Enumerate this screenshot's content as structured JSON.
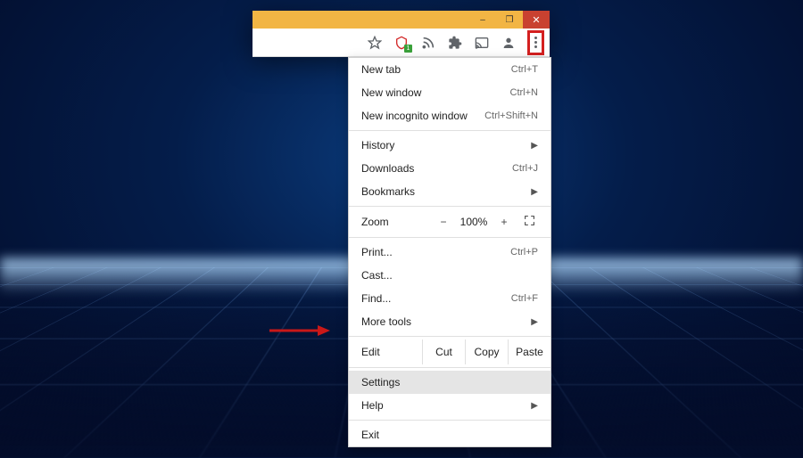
{
  "window": {
    "minimize": "–",
    "maximize": "❐",
    "close": "✕"
  },
  "toolbar": {
    "shield_badge": "1"
  },
  "menu": {
    "new_tab": {
      "label": "New tab",
      "shortcut": "Ctrl+T"
    },
    "new_window": {
      "label": "New window",
      "shortcut": "Ctrl+N"
    },
    "new_incognito": {
      "label": "New incognito window",
      "shortcut": "Ctrl+Shift+N"
    },
    "history": {
      "label": "History"
    },
    "downloads": {
      "label": "Downloads",
      "shortcut": "Ctrl+J"
    },
    "bookmarks": {
      "label": "Bookmarks"
    },
    "zoom": {
      "label": "Zoom",
      "minus": "−",
      "value": "100%",
      "plus": "+"
    },
    "print": {
      "label": "Print...",
      "shortcut": "Ctrl+P"
    },
    "cast": {
      "label": "Cast..."
    },
    "find": {
      "label": "Find...",
      "shortcut": "Ctrl+F"
    },
    "more_tools": {
      "label": "More tools"
    },
    "edit": {
      "label": "Edit",
      "cut": "Cut",
      "copy": "Copy",
      "paste": "Paste"
    },
    "settings": {
      "label": "Settings"
    },
    "help": {
      "label": "Help"
    },
    "exit": {
      "label": "Exit"
    }
  }
}
